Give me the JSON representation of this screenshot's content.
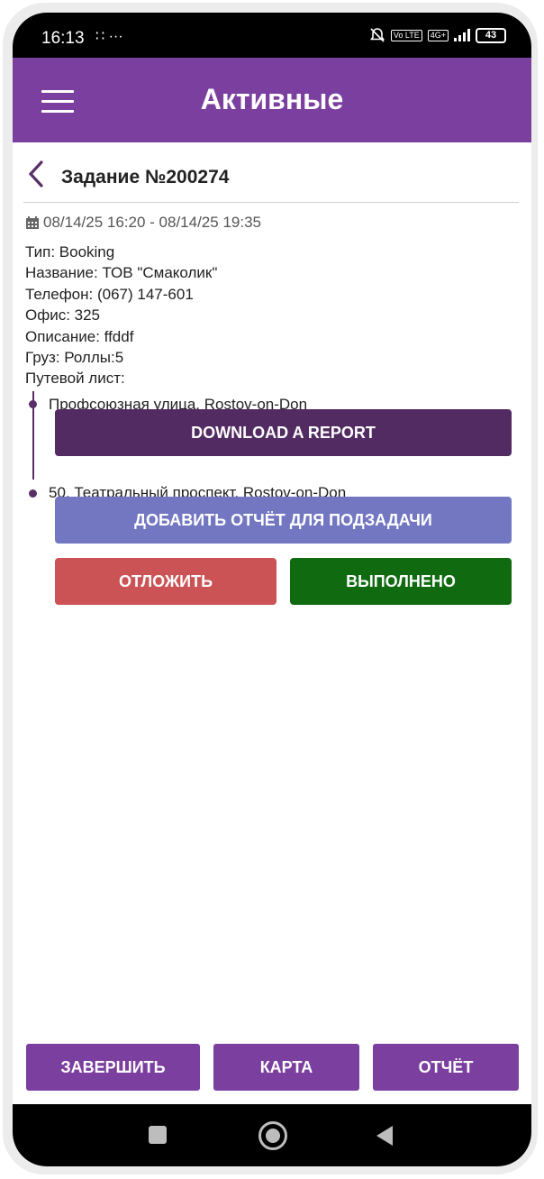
{
  "status_bar": {
    "time": "16:13",
    "left_icons": "∷ ···",
    "battery": "43",
    "badge_volte": "Vo LTE",
    "badge_net": "4G+"
  },
  "app_bar": {
    "title": "Активные",
    "menu_icon": "hamburger-icon"
  },
  "task": {
    "title": "Задание №200274",
    "datetime": "08/14/25 16:20 - 08/14/25 19:35",
    "lines": [
      "Тип: Booking",
      "Название: ТОВ \"Смаколик\"",
      "Телефон: (067) 147-601",
      "Офис: 325",
      "Описание: ffddf",
      "Груз: Роллы:5",
      "Путевой лист:"
    ]
  },
  "stops": [
    {
      "address": "Профсоюзная улица, Rostov-on-Don",
      "button": "DOWNLOAD A REPORT"
    },
    {
      "address": "50, Театральный проспект, Rostov-on-Don",
      "button": "ДОБАВИТЬ ОТЧЁТ ДЛЯ ПОДЗАДАЧИ"
    }
  ],
  "actions": {
    "postpone": "ОТЛОЖИТЬ",
    "done": "ВЫПОЛНЕНО"
  },
  "bottom": {
    "finish": "ЗАВЕРШИТЬ",
    "map": "КАРТА",
    "report": "ОТЧЁТ"
  },
  "colors": {
    "primary": "#7b3f9f",
    "report_button": "#512b62",
    "subtask_button": "#7377c2",
    "postpone_button": "#cc5355",
    "done_button": "#0f6a10"
  }
}
